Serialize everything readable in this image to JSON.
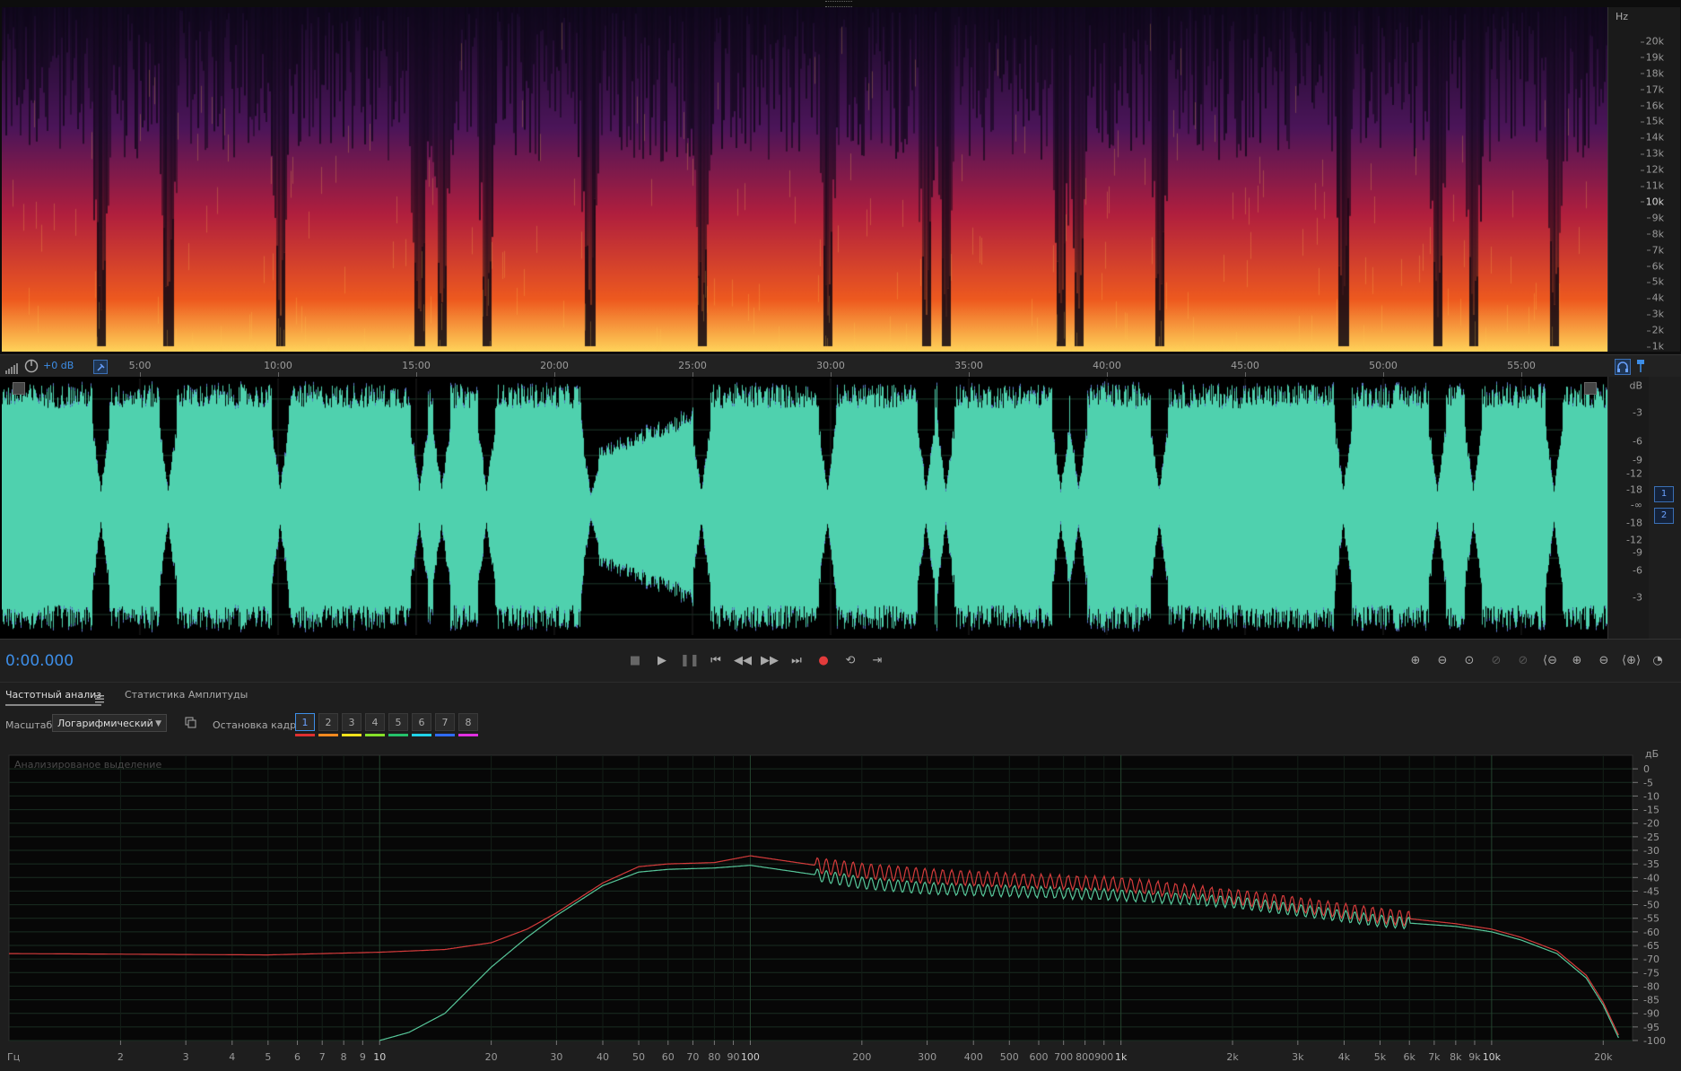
{
  "spectrogram": {
    "unit": "Hz",
    "labels": [
      "20k",
      "19k",
      "18k",
      "17k",
      "16k",
      "15k",
      "14k",
      "13k",
      "12k",
      "11k",
      "10k",
      "9k",
      "8k",
      "7k",
      "6k",
      "5k",
      "4k",
      "3k",
      "2k",
      "1k"
    ]
  },
  "timeline": {
    "gain": "+0 dB",
    "labels": [
      "5:00",
      "10:00",
      "15:00",
      "20:00",
      "25:00",
      "30:00",
      "35:00",
      "40:00",
      "45:00",
      "50:00",
      "55:00"
    ]
  },
  "waveform": {
    "db_labels": [
      "dB",
      "-3",
      "-6",
      "-9",
      "-12",
      "-18",
      "-∞",
      "-18",
      "-12",
      "-9",
      "-6",
      "-3"
    ],
    "channels": [
      "1",
      "2"
    ]
  },
  "transport": {
    "time": "0:00.000",
    "buttons": [
      "stop-icon",
      "play-icon",
      "pause-icon",
      "skip-start-icon",
      "rewind-icon",
      "fast-forward-icon",
      "skip-end-icon",
      "record-icon",
      "loop-icon",
      "skip-selection-icon"
    ],
    "zoom_buttons": [
      "zoom-in-amplitude-icon",
      "zoom-out-amplitude-icon",
      "zoom-reset-icon",
      "zoom-disabled-icon",
      "zoom-disabled-icon",
      "zoom-out-full-icon",
      "zoom-in-icon",
      "zoom-out-icon",
      "zoom-selection-icon",
      "zoom-time-icon"
    ]
  },
  "tabs": {
    "frequency": "Частотный анализ",
    "amplitude": "Статистика Амплитуды"
  },
  "toolbar": {
    "scale_label": "Масштаб:",
    "scale_value": "Логарифмический",
    "freeze_label": "Остановка кадра:",
    "frames": [
      {
        "n": "1",
        "color": "#e03030"
      },
      {
        "n": "2",
        "color": "#ff8a1f"
      },
      {
        "n": "3",
        "color": "#f5e21b"
      },
      {
        "n": "4",
        "color": "#86e028"
      },
      {
        "n": "5",
        "color": "#25c26a"
      },
      {
        "n": "6",
        "color": "#20d3e8"
      },
      {
        "n": "7",
        "color": "#2f6bff"
      },
      {
        "n": "8",
        "color": "#e030e0"
      }
    ]
  },
  "chart_data": {
    "type": "line",
    "title": "Анализированое выделение",
    "xlabel": "Гц",
    "ylabel": "дБ",
    "xscale": "log",
    "xlim": [
      1,
      24000
    ],
    "ylim": [
      -100,
      5
    ],
    "x_ticks": [
      "2",
      "3",
      "4",
      "5",
      "6",
      "7",
      "8",
      "9",
      "10",
      "20",
      "30",
      "40",
      "50",
      "60",
      "70",
      "80",
      "90",
      "100",
      "200",
      "300",
      "400",
      "500",
      "600",
      "700",
      "800",
      "900",
      "1k",
      "2k",
      "3k",
      "4k",
      "5k",
      "6k",
      "7k",
      "8k",
      "9k",
      "10k",
      "20k"
    ],
    "y_ticks": [
      "0",
      "-5",
      "-10",
      "-15",
      "-20",
      "-25",
      "-30",
      "-35",
      "-40",
      "-45",
      "-50",
      "-55",
      "-60",
      "-65",
      "-70",
      "-75",
      "-80",
      "-85",
      "-90",
      "-95",
      "-100"
    ],
    "series": [
      {
        "color": "#d43b3b",
        "x": [
          1,
          5,
          10,
          15,
          20,
          25,
          30,
          40,
          50,
          60,
          80,
          100,
          150,
          200,
          300,
          500,
          1000,
          2000,
          3000,
          5000,
          8000,
          10000,
          12000,
          15000,
          18000,
          20000,
          22000
        ],
        "y": [
          -68,
          -68.5,
          -67.5,
          -66.5,
          -64,
          -59,
          -53,
          -42,
          -36,
          -35,
          -34.5,
          -32,
          -35.5,
          -37.5,
          -39.5,
          -41,
          -42.5,
          -47,
          -50,
          -54,
          -57,
          -59,
          -62,
          -67,
          -76,
          -86,
          -98
        ]
      },
      {
        "color": "#57c79a",
        "x": [
          10,
          12,
          15,
          20,
          25,
          30,
          40,
          50,
          60,
          80,
          100,
          150,
          200,
          300,
          500,
          1000,
          2000,
          3000,
          5000,
          8000,
          10000,
          12000,
          15000,
          18000,
          20000,
          22000
        ],
        "y": [
          -100,
          -97,
          -90,
          -73,
          -62,
          -54,
          -43,
          -38,
          -37,
          -36.5,
          -35.5,
          -39,
          -42,
          -44,
          -45,
          -46.5,
          -49,
          -52,
          -56,
          -58,
          -60,
          -63,
          -68,
          -77,
          -87,
          -99
        ]
      }
    ]
  }
}
